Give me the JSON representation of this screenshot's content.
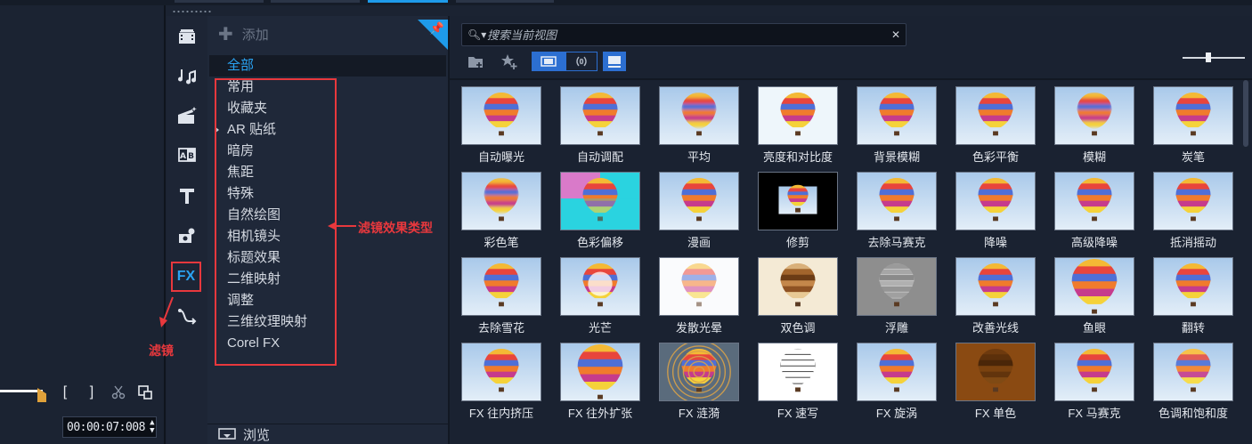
{
  "preview": {
    "timecode": "00:00:07:008",
    "mark_in_label": "[",
    "mark_out_label": "]"
  },
  "toolbar": {
    "fx_label": "FX",
    "icons": [
      "media-icon",
      "audio-icon",
      "instant-project-icon",
      "transition-icon",
      "title-icon",
      "graphics-icon",
      "filter-icon",
      "path-icon"
    ]
  },
  "categories": {
    "add_label": "添加",
    "browse_label": "浏览",
    "items": [
      {
        "label": "全部",
        "selected": true
      },
      {
        "label": "常用"
      },
      {
        "label": "收藏夹"
      },
      {
        "label": "AR 贴纸"
      },
      {
        "label": "暗房"
      },
      {
        "label": "焦距"
      },
      {
        "label": "特殊"
      },
      {
        "label": "自然绘图"
      },
      {
        "label": "相机镜头"
      },
      {
        "label": "标题效果"
      },
      {
        "label": "二维映射"
      },
      {
        "label": "调整"
      },
      {
        "label": "三维纹理映射"
      },
      {
        "label": "Corel FX"
      }
    ]
  },
  "annotations": {
    "filter_types": "滤镜效果类型",
    "filter": "滤镜"
  },
  "gallery": {
    "search_placeholder": "搜索当前视图",
    "filters": [
      {
        "label": "自动曝光",
        "style": "normal"
      },
      {
        "label": "自动调配",
        "style": "normal"
      },
      {
        "label": "平均",
        "style": "blur"
      },
      {
        "label": "亮度和对比度",
        "style": "bright"
      },
      {
        "label": "背景模糊",
        "style": "normal"
      },
      {
        "label": "色彩平衡",
        "style": "normal"
      },
      {
        "label": "模糊",
        "style": "blur"
      },
      {
        "label": "炭笔",
        "style": "normal"
      },
      {
        "label": "彩色笔",
        "style": "soft"
      },
      {
        "label": "色彩偏移",
        "style": "shift"
      },
      {
        "label": "漫画",
        "style": "normal"
      },
      {
        "label": "修剪",
        "style": "crop"
      },
      {
        "label": "去除马赛克",
        "style": "normal"
      },
      {
        "label": "降噪",
        "style": "normal"
      },
      {
        "label": "高级降噪",
        "style": "normal"
      },
      {
        "label": "抵消摇动",
        "style": "normal"
      },
      {
        "label": "去除雪花",
        "style": "normal"
      },
      {
        "label": "光芒",
        "style": "flare"
      },
      {
        "label": "发散光晕",
        "style": "glow"
      },
      {
        "label": "双色调",
        "style": "duotone"
      },
      {
        "label": "浮雕",
        "style": "emboss"
      },
      {
        "label": "改善光线",
        "style": "normal"
      },
      {
        "label": "鱼眼",
        "style": "fisheye"
      },
      {
        "label": "翻转",
        "style": "normal"
      },
      {
        "label": "FX 往内挤压",
        "style": "normal"
      },
      {
        "label": "FX 往外扩张",
        "style": "bulge"
      },
      {
        "label": "FX 涟漪",
        "style": "ripple"
      },
      {
        "label": "FX 速写",
        "style": "sketch"
      },
      {
        "label": "FX 旋涡",
        "style": "normal"
      },
      {
        "label": "FX 单色",
        "style": "mono"
      },
      {
        "label": "FX 马赛克",
        "style": "normal"
      },
      {
        "label": "色调和饱和度",
        "style": "hue"
      }
    ]
  },
  "colors": {
    "accent": "#1e9bea",
    "annotation": "#e8383d",
    "background": "#1b2332"
  }
}
